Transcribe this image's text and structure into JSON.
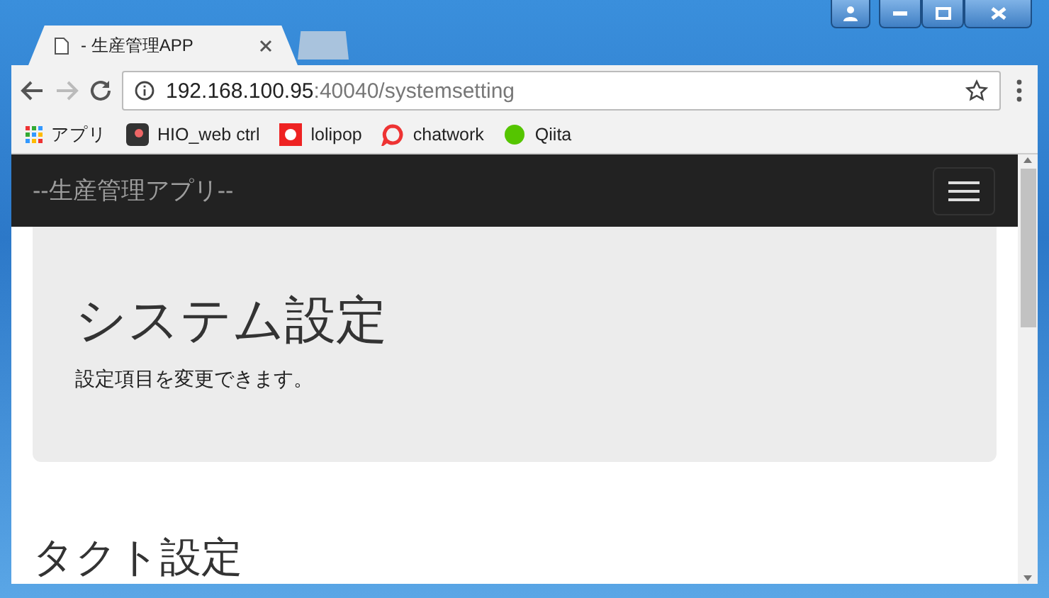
{
  "browser": {
    "tabs": [
      {
        "title": "- 生産管理APP",
        "selected": true
      },
      {
        "selected": false
      }
    ],
    "address": {
      "host": "192.168.100.95",
      "rest": ":40040/systemsetting"
    },
    "bookmarks": [
      {
        "label": "アプリ",
        "kind": "apps"
      },
      {
        "label": "HIO_web ctrl",
        "kind": "hio"
      },
      {
        "label": "lolipop",
        "kind": "lolipop"
      },
      {
        "label": "chatwork",
        "kind": "chatwork"
      },
      {
        "label": "Qiita",
        "kind": "qiita"
      }
    ]
  },
  "navbar": {
    "brand": "--生産管理アプリ--"
  },
  "jumbotron": {
    "title": "システム設定",
    "lead": "設定項目を変更できます。"
  },
  "section": {
    "title": "タクト設定"
  }
}
